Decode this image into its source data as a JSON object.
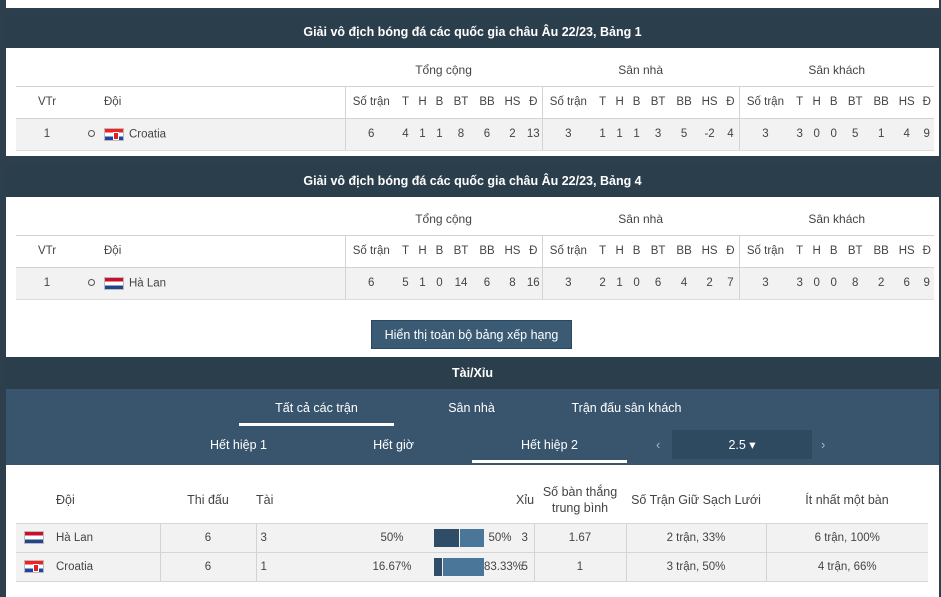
{
  "groups": [
    {
      "title": "Giải vô địch bóng đá các quốc gia châu Âu 22/23, Bảng 1",
      "col_groups": [
        "Tổng cộng",
        "Sân nhà",
        "Sân khách"
      ],
      "headers": {
        "rank": "VTr",
        "team": "Đội",
        "stats": [
          "Số trận",
          "T",
          "H",
          "B",
          "BT",
          "BB",
          "HS",
          "Đ"
        ]
      },
      "rows": [
        {
          "rank": "1",
          "team": "Croatia",
          "flag": "croatia-flag",
          "total": [
            "6",
            "4",
            "1",
            "1",
            "8",
            "6",
            "2",
            "13"
          ],
          "home": [
            "3",
            "1",
            "1",
            "1",
            "3",
            "5",
            "-2",
            "4"
          ],
          "away": [
            "3",
            "3",
            "0",
            "0",
            "5",
            "1",
            "4",
            "9"
          ]
        }
      ]
    },
    {
      "title": "Giải vô địch bóng đá các quốc gia châu Âu 22/23, Bảng 4",
      "col_groups": [
        "Tổng cộng",
        "Sân nhà",
        "Sân khách"
      ],
      "headers": {
        "rank": "VTr",
        "team": "Đội",
        "stats": [
          "Số trận",
          "T",
          "H",
          "B",
          "BT",
          "BB",
          "HS",
          "Đ"
        ]
      },
      "rows": [
        {
          "rank": "1",
          "team": "Hà Lan",
          "flag": "netherlands-flag",
          "total": [
            "6",
            "5",
            "1",
            "0",
            "14",
            "6",
            "8",
            "16"
          ],
          "home": [
            "3",
            "2",
            "1",
            "0",
            "6",
            "4",
            "2",
            "7"
          ],
          "away": [
            "3",
            "3",
            "0",
            "0",
            "8",
            "2",
            "6",
            "9"
          ]
        }
      ]
    }
  ],
  "show_all_button": "Hiển thị toàn bộ bảng xếp hạng",
  "overunder": {
    "title": "Tài/Xỉu",
    "tabs": [
      "Tất cả các trận",
      "Sân nhà",
      "Trận đấu sân khách"
    ],
    "active_tab": 0,
    "periods": [
      "Hết hiệp 1",
      "Hết giờ",
      "Hết hiệp 2"
    ],
    "active_period": 2,
    "line_prev": "‹",
    "line_value": "2.5 ▾",
    "line_next": "›",
    "headers": [
      "Đội",
      "Thi đấu",
      "Tài",
      "Xỉu",
      "Số bàn thắng trung bình",
      "Số Trận Giữ Sạch Lưới",
      "Ít nhất một bàn"
    ],
    "rows": [
      {
        "team": "Hà Lan",
        "flag": "netherlands-flag",
        "played": "6",
        "over": "3",
        "over_pct": "50%",
        "under_pct": "50%",
        "under": "3",
        "avg": "1.67",
        "clean": "2 trận, 33%",
        "score": "6 trận, 100%",
        "over_fraction": 0.5
      },
      {
        "team": "Croatia",
        "flag": "croatia-flag",
        "played": "6",
        "over": "1",
        "over_pct": "16.67%",
        "under_pct": "83.33%",
        "under": "5",
        "avg": "1",
        "clean": "3 trận, 50%",
        "score": "4 trận, 66%",
        "over_fraction": 0.1667
      }
    ],
    "colors": {
      "over": "#2f4d66",
      "under": "#4a7699"
    }
  }
}
